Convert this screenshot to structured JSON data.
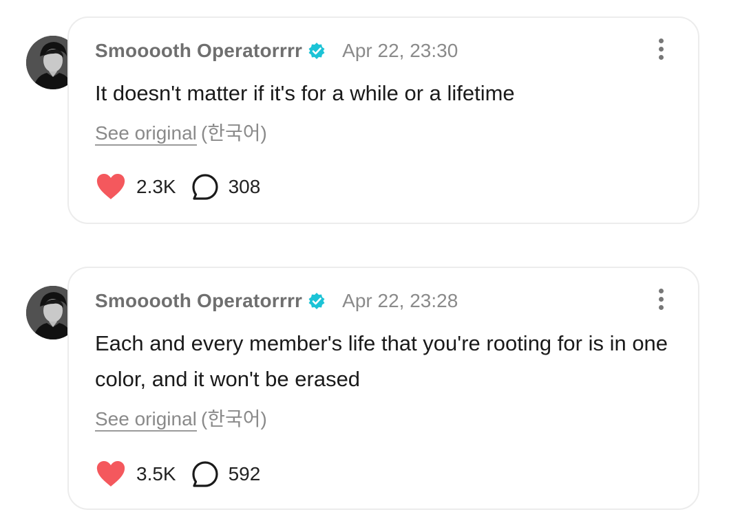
{
  "posts": [
    {
      "author": "Smooooth Operatorrrr",
      "verified": true,
      "timestamp": "Apr 22, 23:30",
      "text": "It doesn't matter if it's for a while or a lifetime",
      "see_original": "See original",
      "language": "(한국어)",
      "likes": "2.3K",
      "comments": "308"
    },
    {
      "author": "Smooooth Operatorrrr",
      "verified": true,
      "timestamp": "Apr 22, 23:28",
      "text": "Each and every member's life that you're rooting for is in one color, and it won't be erased",
      "see_original": "See original",
      "language": "(한국어)",
      "likes": "3.5K",
      "comments": "592"
    }
  ],
  "colors": {
    "heart": "#f4585d",
    "verified": "#1cc3d6",
    "author": "#6f6f6f",
    "meta": "#8a8a8a",
    "text": "#1a1a1a",
    "card_border": "#ececec"
  },
  "icons": {
    "like": "heart-icon",
    "comment": "speech-bubble-icon",
    "verified": "verified-badge-icon",
    "more": "vertical-ellipsis-icon"
  }
}
